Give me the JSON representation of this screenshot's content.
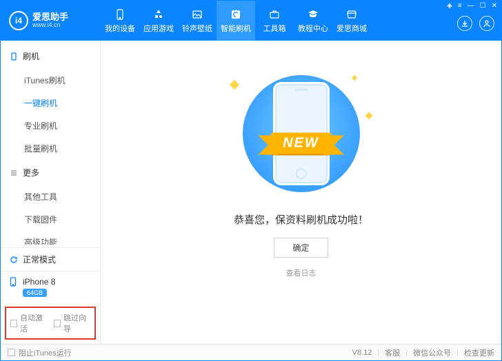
{
  "brand": {
    "logo_text": "i4",
    "name": "爱思助手",
    "site": "www.i4.cn"
  },
  "nav": {
    "items": [
      {
        "label": "我的设备"
      },
      {
        "label": "应用游戏"
      },
      {
        "label": "铃声壁纸"
      },
      {
        "label": "智能刷机"
      },
      {
        "label": "工具箱"
      },
      {
        "label": "教程中心"
      },
      {
        "label": "爱思商城"
      }
    ],
    "active_index": 3
  },
  "sidebar": {
    "sections": [
      {
        "title": "刷机",
        "items": [
          "iTunes刷机",
          "一键刷机",
          "专业刷机",
          "批量刷机"
        ],
        "active_item_index": 1
      },
      {
        "title": "更多",
        "items": [
          "其他工具",
          "下载固件",
          "高级功能"
        ],
        "active_item_index": -1
      }
    ],
    "mode_label": "正常模式",
    "device": {
      "name": "iPhone 8",
      "storage": "64GB"
    },
    "check_auto_activate": "自动激活",
    "check_skip_guide": "跳过向导"
  },
  "main": {
    "ribbon_text": "NEW",
    "success_text": "恭喜您，保资料刷机成功啦！",
    "ok_button": "确定",
    "view_log": "查看日志"
  },
  "statusbar": {
    "block_itunes": "阻止iTunes运行",
    "version": "V8.12",
    "support": "客服",
    "wechat": "微信公众号",
    "check_update": "检查更新"
  }
}
